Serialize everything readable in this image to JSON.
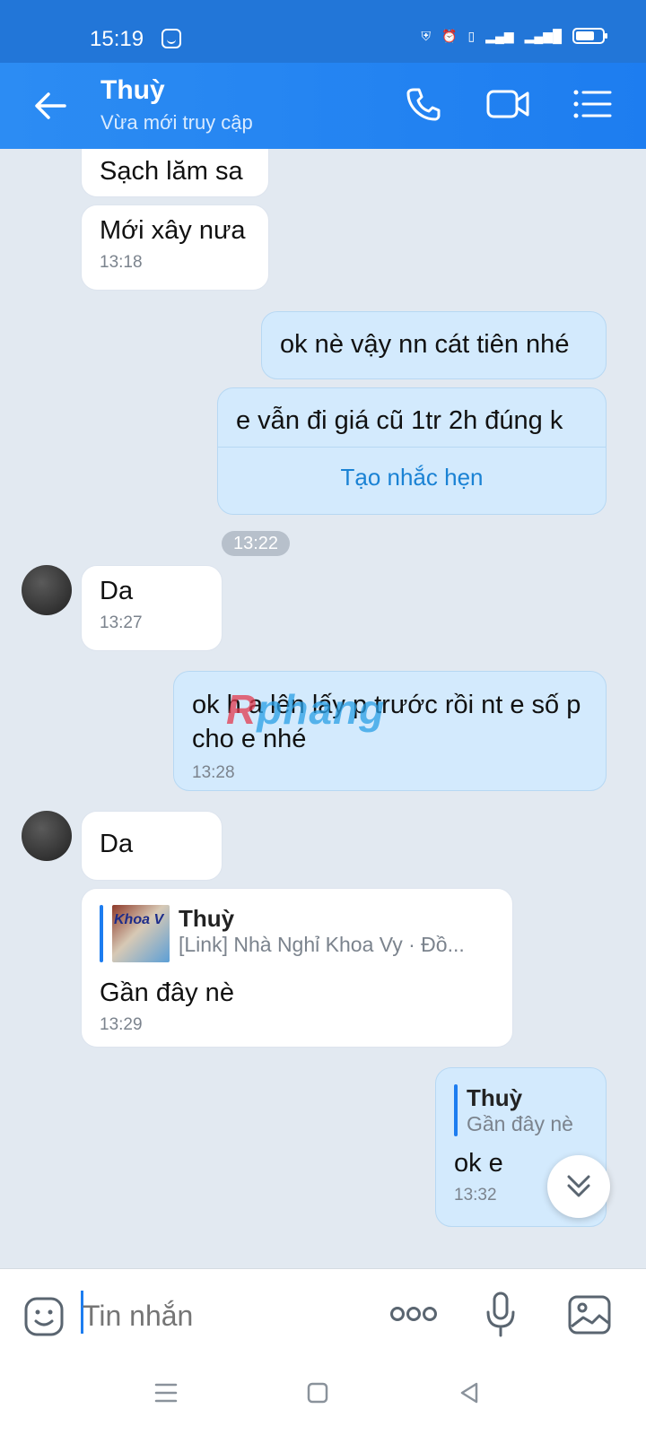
{
  "status": {
    "time": "15:19",
    "icons": [
      "vpn-icon",
      "alarm-icon",
      "vibrate-icon",
      "4g-signal-icon",
      "signal-icon",
      "battery-icon"
    ]
  },
  "header": {
    "name": "Thuỳ",
    "status": "Vừa mới truy cập"
  },
  "messages": {
    "m1": {
      "text": "Sạch lăm sa"
    },
    "m2": {
      "text": "Mới xây nưa",
      "time": "13:18"
    },
    "m3": {
      "text": "ok nè vậy nn cát tiên nhé"
    },
    "m4": {
      "text": "e vẫn đi giá cũ 1tr 2h đúng k",
      "action": "Tạo nhắc hẹn"
    },
    "pill": "13:22",
    "m5": {
      "text": "Da",
      "time": "13:27"
    },
    "m6": {
      "text": "ok h a lên lấy p trước rồi nt e số p cho e nhé",
      "time": "13:28"
    },
    "m7": {
      "text": "Da"
    },
    "m8": {
      "quote_name": "Thuỳ",
      "quote_text": "[Link] Nhà Nghỉ Khoa Vy · Đồ...",
      "thumb_text": "Khoa V",
      "text": "Gần đây nè",
      "time": "13:29"
    },
    "m9": {
      "quote_name": "Thuỳ",
      "quote_text": "Gần đây nè",
      "text": "ok e",
      "time": "13:32"
    }
  },
  "watermark": {
    "a": "R",
    "b": "phang"
  },
  "composer": {
    "placeholder": "Tin nhắn"
  },
  "colors": {
    "header": "#1d7df0",
    "chat_bg": "#e2e9f1",
    "outgoing": "#d3eafd",
    "incoming": "#ffffff",
    "accent": "#1a82d4"
  }
}
